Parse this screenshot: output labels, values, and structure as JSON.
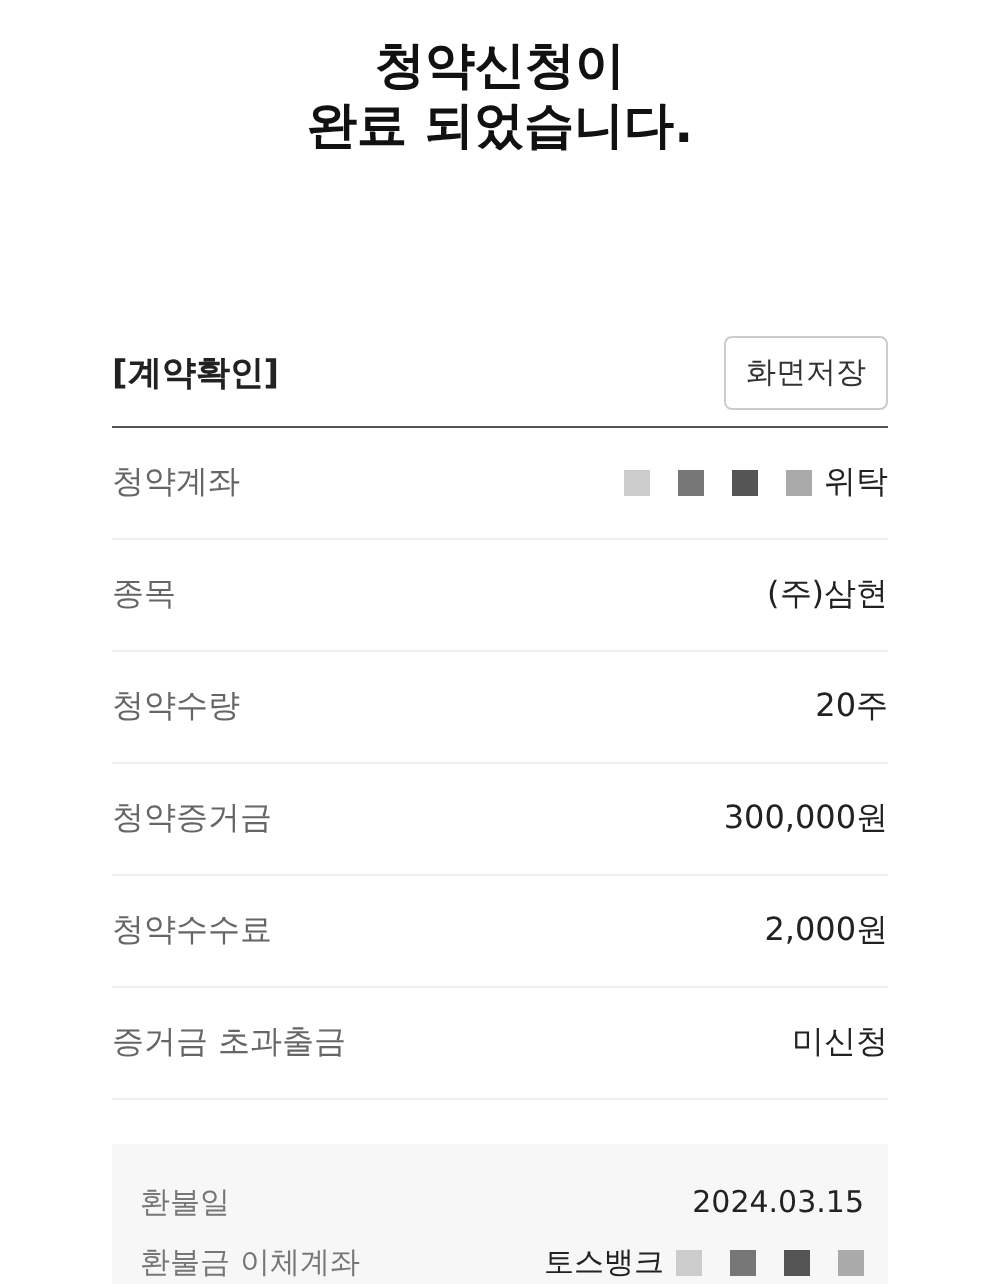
{
  "title": [
    "청약신청이",
    "완료 되었습니다."
  ],
  "section": {
    "heading": "[계약확인]",
    "button": "화면저장"
  },
  "rows": [
    {
      "label": "청약계좌",
      "value": "위탁",
      "redacted": true
    },
    {
      "label": "종목",
      "value": "(주)삼현",
      "redacted": false
    },
    {
      "label": "청약수량",
      "value": "20주",
      "redacted": false
    },
    {
      "label": "청약증거금",
      "value": "300,000원",
      "redacted": false
    },
    {
      "label": "청약수수료",
      "value": "2,000원",
      "redacted": false
    },
    {
      "label": "증거금 초과출금",
      "value": "미신청",
      "redacted": false
    }
  ],
  "refund": [
    {
      "label": "환불일",
      "value": "2024.03.15",
      "redacted": false
    },
    {
      "label": "환불금 이체계좌",
      "value": "토스뱅크",
      "redacted": true
    }
  ]
}
